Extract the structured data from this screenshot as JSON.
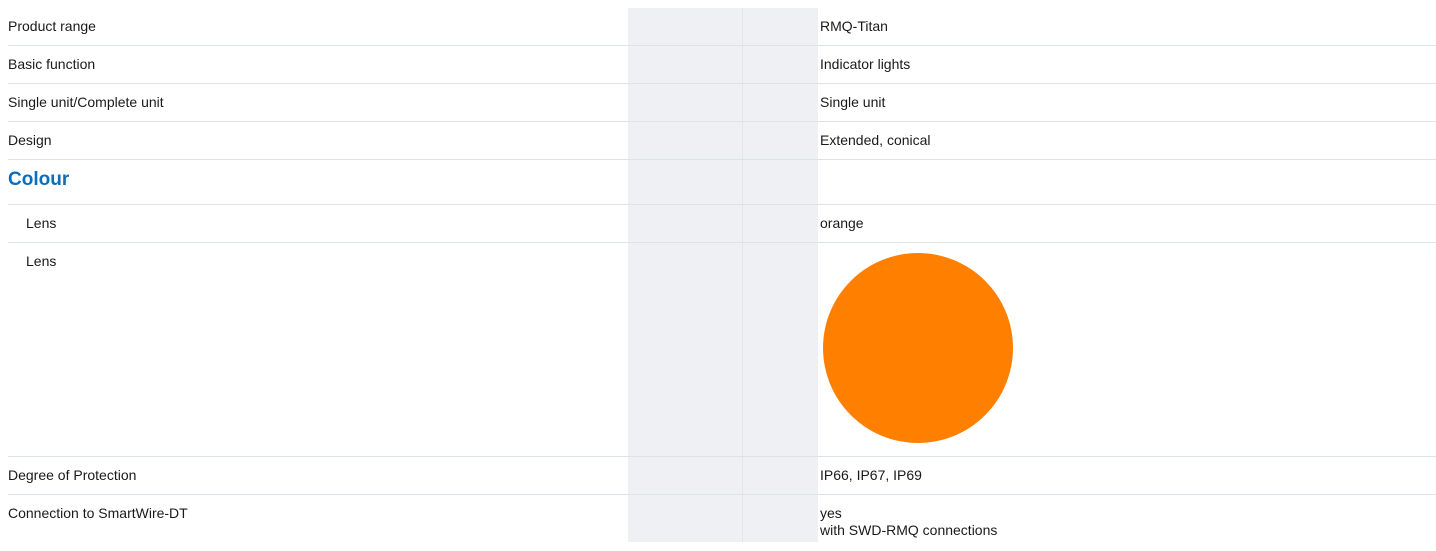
{
  "rows": [
    {
      "label": "Product range",
      "value": "RMQ-Titan"
    },
    {
      "label": "Basic function",
      "value": "Indicator lights"
    },
    {
      "label": "Single unit/Complete unit",
      "value": "Single unit"
    },
    {
      "label": "Design",
      "value": "Extended, conical"
    }
  ],
  "colour_section": {
    "title": "Colour",
    "lens_text": {
      "label": "Lens",
      "value": "orange"
    },
    "lens_swatch": {
      "label": "Lens",
      "color": "#ff7f00"
    }
  },
  "rows_after": [
    {
      "label": "Degree of Protection",
      "value": "IP66, IP67, IP69"
    },
    {
      "label": "Connection to SmartWire-DT",
      "value_line1": "yes",
      "value_line2": "with SWD-RMQ connections"
    }
  ]
}
